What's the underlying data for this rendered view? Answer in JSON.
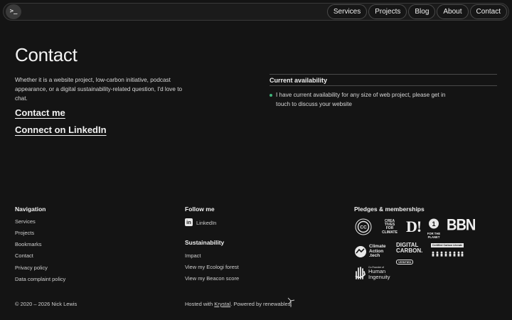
{
  "header": {
    "logo_text": ">_",
    "nav": [
      "Services",
      "Projects",
      "Blog",
      "About",
      "Contact"
    ]
  },
  "main": {
    "title": "Contact",
    "intro": "Whether it is a website project, low-carbon initiative, podcast appearance, or a digital sustainability-related question, I'd love to chat.",
    "contact_link": "Contact me",
    "linkedin_link": "Connect on LinkedIn",
    "availability_title": "Current availability",
    "availability_text": "I have current availability for any size of web project, please get in touch to discuss your website",
    "availability_color": "#3fb37a"
  },
  "footer": {
    "navigation": {
      "heading": "Navigation",
      "links": [
        "Services",
        "Projects",
        "Bookmarks",
        "Contact",
        "Privacy policy",
        "Data complaint policy"
      ]
    },
    "follow": {
      "heading": "Follow me",
      "linkedin": "LinkedIn",
      "linkedin_icon_text": "in"
    },
    "sustainability": {
      "heading": "Sustainability",
      "links": [
        "Impact",
        "View my Ecologi forest",
        "View my Beacon score"
      ]
    },
    "pledges": {
      "heading": "Pledges & memberships",
      "logos": {
        "cc": "CC",
        "creatives_line1": "CREA",
        "creatives_line2": "TIVES",
        "creatives_line3": "FOR",
        "creatives_line4": "CLIMATE",
        "d": "D!",
        "planet_number": "1",
        "planet_line1": "FOR THE",
        "planet_line2": "PLANET",
        "bbn": "BBN",
        "climate_line1": "Climate",
        "climate_line2": "Action",
        "climate_line3": ".tech",
        "digital_line1": "DIGITAL",
        "digital_line2": "CARBON.",
        "digital_line3": "VERIFIED",
        "literate": "Certified Carbon Literate",
        "human_small": "Co-Founder of",
        "human_line1": "Human",
        "human_line2": "Ingenuity"
      }
    },
    "copyright": "© 2020 – 2026 Nick Lewis",
    "hosted_pre": "Hosted with ",
    "hosted_link": "Krystal",
    "hosted_post": ". Powered by renewables."
  }
}
